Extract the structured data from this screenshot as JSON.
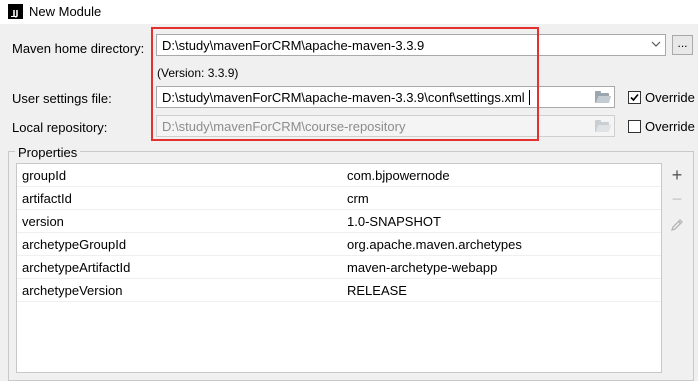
{
  "window": {
    "app_icon_text": "IJ",
    "title": "New Module"
  },
  "maven_home": {
    "label": "Maven home directory:",
    "value": "D:\\study\\mavenForCRM\\apache-maven-3.3.9",
    "browse_label": "...",
    "version_text": "(Version: 3.3.9)"
  },
  "user_settings": {
    "label": "User settings file:",
    "value": "D:\\study\\mavenForCRM\\apache-maven-3.3.9\\conf\\settings.xml",
    "override_label": "Override",
    "override_checked": true
  },
  "local_repo": {
    "label": "Local repository:",
    "value": "D:\\study\\mavenForCRM\\course-repository",
    "override_label": "Override",
    "override_checked": false
  },
  "properties": {
    "title": "Properties",
    "rows": [
      {
        "key": "groupId",
        "value": "com.bjpowernode"
      },
      {
        "key": "artifactId",
        "value": "crm"
      },
      {
        "key": "version",
        "value": "1.0-SNAPSHOT"
      },
      {
        "key": "archetypeGroupId",
        "value": "org.apache.maven.archetypes"
      },
      {
        "key": "archetypeArtifactId",
        "value": "maven-archetype-webapp"
      },
      {
        "key": "archetypeVersion",
        "value": "RELEASE"
      }
    ],
    "toolbar": {
      "add": "+",
      "remove": "−"
    }
  },
  "colors": {
    "highlight": "#e4312d",
    "background": "#f0f0f0"
  }
}
